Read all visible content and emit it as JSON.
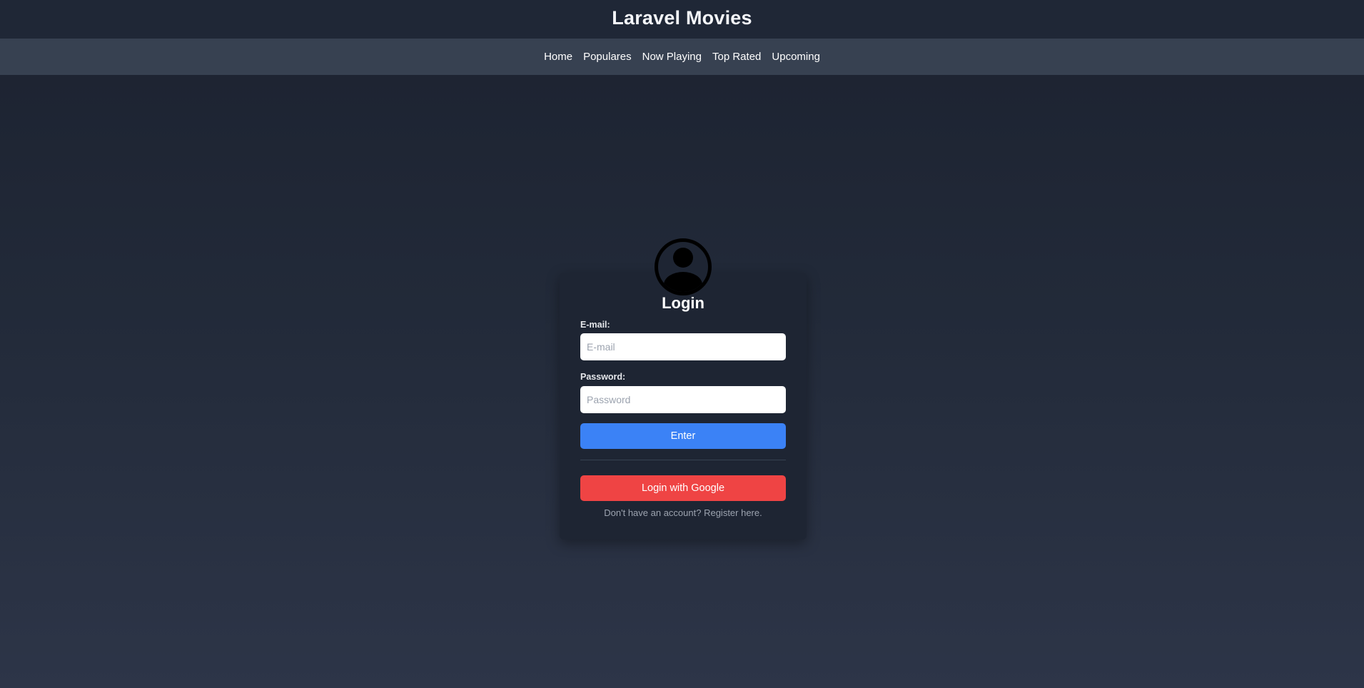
{
  "header": {
    "title": "Laravel Movies"
  },
  "nav": {
    "items": [
      {
        "label": "Home"
      },
      {
        "label": "Populares"
      },
      {
        "label": "Now Playing"
      },
      {
        "label": "Top Rated"
      },
      {
        "label": "Upcoming"
      }
    ]
  },
  "login": {
    "avatar_icon": "user-circle-icon",
    "title": "Login",
    "email": {
      "label": "E-mail:",
      "placeholder": "E-mail",
      "value": ""
    },
    "password": {
      "label": "Password:",
      "placeholder": "Password",
      "value": ""
    },
    "enter_label": "Enter",
    "google_label": "Login with Google",
    "register_prefix": "Don't have an account? ",
    "register_link": "Register here."
  },
  "colors": {
    "primary": "#3b82f6",
    "google": "#ef4444",
    "nav_bg": "#374151",
    "header_bg": "#1f2736"
  }
}
